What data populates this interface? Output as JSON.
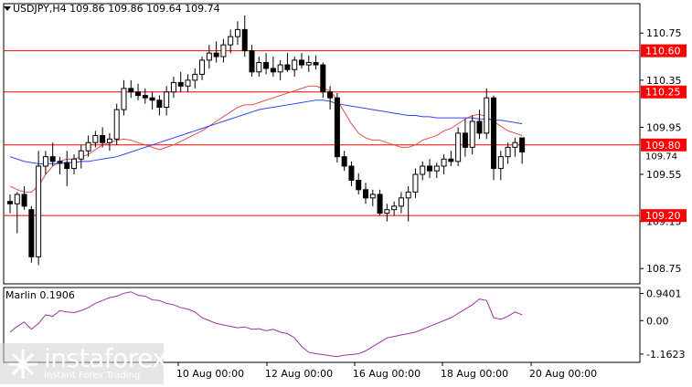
{
  "chart_data": [
    {
      "type": "candlestick",
      "title": "USDJPY,H4  109.86 109.86 109.64 109.74",
      "symbol": "USDJPY",
      "timeframe": "H4",
      "ohlc_last": {
        "open": 109.86,
        "high": 109.86,
        "low": 109.64,
        "close": 109.74
      },
      "ylim": [
        108.62,
        111.0
      ],
      "y_ticks": [
        "110.75",
        "110.35",
        "109.95",
        "109.55",
        "109.15",
        "108.75"
      ],
      "x_ticks": [
        "10 Aug 00:00",
        "12 Aug 00:00",
        "16 Aug 00:00",
        "18 Aug 00:00",
        "20 Aug 00:00"
      ],
      "levels": [
        {
          "label": "110.60",
          "value": 110.6,
          "color": "#ff0000"
        },
        {
          "label": "110.25",
          "value": 110.25,
          "color": "#ff0000"
        },
        {
          "label": "109.80",
          "value": 109.8,
          "color": "#ff0000"
        },
        {
          "label": "109.20",
          "value": 109.2,
          "color": "#ff0000"
        }
      ],
      "price_marker": {
        "label": "109.74",
        "value": 109.74
      },
      "candles": [
        [
          109.32,
          109.38,
          109.22,
          109.3
        ],
        [
          109.3,
          109.4,
          109.05,
          109.38
        ],
        [
          109.38,
          109.45,
          109.25,
          109.28
        ],
        [
          109.25,
          109.28,
          108.8,
          108.85
        ],
        [
          108.85,
          109.75,
          108.78,
          109.62
        ],
        [
          109.62,
          109.75,
          109.55,
          109.7
        ],
        [
          109.7,
          109.82,
          109.62,
          109.66
        ],
        [
          109.66,
          109.7,
          109.55,
          109.65
        ],
        [
          109.65,
          109.75,
          109.45,
          109.6
        ],
        [
          109.6,
          109.72,
          109.55,
          109.68
        ],
        [
          109.68,
          109.8,
          109.6,
          109.75
        ],
        [
          109.75,
          109.88,
          109.7,
          109.82
        ],
        [
          109.82,
          109.92,
          109.78,
          109.88
        ],
        [
          109.88,
          109.95,
          109.78,
          109.82
        ],
        [
          109.82,
          109.9,
          109.75,
          109.85
        ],
        [
          109.85,
          110.15,
          109.8,
          110.1
        ],
        [
          110.1,
          110.35,
          110.05,
          110.28
        ],
        [
          110.28,
          110.35,
          110.2,
          110.25
        ],
        [
          110.25,
          110.32,
          110.18,
          110.22
        ],
        [
          110.22,
          110.28,
          110.15,
          110.2
        ],
        [
          110.2,
          110.25,
          110.1,
          110.18
        ],
        [
          110.18,
          110.22,
          110.05,
          110.12
        ],
        [
          110.12,
          110.3,
          110.05,
          110.25
        ],
        [
          110.25,
          110.38,
          110.2,
          110.33
        ],
        [
          110.33,
          110.42,
          110.25,
          110.3
        ],
        [
          110.3,
          110.4,
          110.25,
          110.35
        ],
        [
          110.35,
          110.45,
          110.28,
          110.4
        ],
        [
          110.4,
          110.55,
          110.35,
          110.52
        ],
        [
          110.52,
          110.65,
          110.45,
          110.58
        ],
        [
          110.58,
          110.68,
          110.5,
          110.55
        ],
        [
          110.55,
          110.7,
          110.5,
          110.65
        ],
        [
          110.65,
          110.78,
          110.58,
          110.72
        ],
        [
          110.72,
          110.85,
          110.65,
          110.78
        ],
        [
          110.78,
          110.9,
          110.55,
          110.6
        ],
        [
          110.6,
          110.65,
          110.38,
          110.42
        ],
        [
          110.42,
          110.55,
          110.38,
          110.5
        ],
        [
          110.5,
          110.58,
          110.4,
          110.45
        ],
        [
          110.45,
          110.55,
          110.38,
          110.42
        ],
        [
          110.42,
          110.52,
          110.35,
          110.48
        ],
        [
          110.48,
          110.58,
          110.42,
          110.44
        ],
        [
          110.44,
          110.55,
          110.38,
          110.52
        ],
        [
          110.52,
          110.58,
          110.45,
          110.48
        ],
        [
          110.48,
          110.56,
          110.42,
          110.5
        ],
        [
          110.5,
          110.56,
          110.44,
          110.48
        ],
        [
          110.48,
          110.5,
          110.2,
          110.25
        ],
        [
          110.25,
          110.3,
          110.1,
          110.2
        ],
        [
          110.2,
          110.24,
          109.65,
          109.7
        ],
        [
          109.7,
          109.75,
          109.58,
          109.62
        ],
        [
          109.62,
          109.66,
          109.45,
          109.5
        ],
        [
          109.5,
          109.56,
          109.38,
          109.42
        ],
        [
          109.42,
          109.48,
          109.3,
          109.35
        ],
        [
          109.35,
          109.42,
          109.28,
          109.38
        ],
        [
          109.38,
          109.42,
          109.2,
          109.22
        ],
        [
          109.22,
          109.3,
          109.15,
          109.25
        ],
        [
          109.25,
          109.32,
          109.2,
          109.28
        ],
        [
          109.28,
          109.4,
          109.22,
          109.35
        ],
        [
          109.35,
          109.45,
          109.15,
          109.4
        ],
        [
          109.4,
          109.6,
          109.35,
          109.55
        ],
        [
          109.55,
          109.66,
          109.5,
          109.62
        ],
        [
          109.62,
          109.68,
          109.52,
          109.58
        ],
        [
          109.58,
          109.65,
          109.52,
          109.62
        ],
        [
          109.62,
          109.72,
          109.55,
          109.68
        ],
        [
          109.68,
          109.75,
          109.62,
          109.66
        ],
        [
          109.66,
          109.95,
          109.62,
          109.9
        ],
        [
          109.9,
          110.02,
          109.7,
          109.78
        ],
        [
          109.78,
          110.05,
          109.72,
          110.0
        ],
        [
          110.0,
          110.1,
          109.85,
          109.9
        ],
        [
          109.9,
          110.28,
          109.85,
          110.2
        ],
        [
          110.2,
          110.22,
          109.5,
          109.6
        ],
        [
          109.6,
          109.75,
          109.5,
          109.7
        ],
        [
          109.7,
          109.82,
          109.64,
          109.78
        ],
        [
          109.78,
          109.86,
          109.7,
          109.82
        ],
        [
          109.86,
          109.86,
          109.64,
          109.74
        ]
      ],
      "series": [
        {
          "name": "",
          "color": "#e05050",
          "values": [
            109.45,
            109.42,
            109.4,
            109.4,
            109.45,
            109.55,
            109.62,
            109.66,
            109.68,
            109.68,
            109.7,
            109.72,
            109.76,
            109.8,
            109.82,
            109.84,
            109.85,
            109.84,
            109.82,
            109.8,
            109.78,
            109.76,
            109.78,
            109.8,
            109.83,
            109.86,
            109.89,
            109.92,
            109.96,
            110.0,
            110.04,
            110.08,
            110.12,
            110.14,
            110.14,
            110.16,
            110.18,
            110.2,
            110.22,
            110.24,
            110.26,
            110.28,
            110.3,
            110.3,
            110.28,
            110.26,
            110.18,
            110.08,
            109.98,
            109.9,
            109.86,
            109.84,
            109.84,
            109.82,
            109.8,
            109.78,
            109.78,
            109.8,
            109.84,
            109.86,
            109.88,
            109.92,
            109.94,
            109.98,
            110.02,
            110.05,
            110.06,
            110.04,
            110.0,
            109.96,
            109.92,
            109.9,
            109.88
          ]
        },
        {
          "name": "",
          "color": "#3344ee",
          "values": [
            109.7,
            109.68,
            109.66,
            109.65,
            109.64,
            109.64,
            109.64,
            109.64,
            109.65,
            109.65,
            109.66,
            109.66,
            109.67,
            109.68,
            109.69,
            109.7,
            109.72,
            109.74,
            109.76,
            109.78,
            109.8,
            109.82,
            109.84,
            109.86,
            109.88,
            109.9,
            109.92,
            109.94,
            109.96,
            109.98,
            110.0,
            110.02,
            110.04,
            110.06,
            110.08,
            110.1,
            110.11,
            110.12,
            110.13,
            110.14,
            110.15,
            110.16,
            110.17,
            110.18,
            110.18,
            110.17,
            110.15,
            110.14,
            110.13,
            110.12,
            110.11,
            110.1,
            110.09,
            110.08,
            110.07,
            110.06,
            110.05,
            110.05,
            110.04,
            110.04,
            110.03,
            110.03,
            110.03,
            110.03,
            110.03,
            110.03,
            110.02,
            110.02,
            110.01,
            110.01,
            110.0,
            109.99,
            109.98
          ]
        }
      ]
    },
    {
      "type": "line",
      "title": "Marlin 0.1906",
      "ylim": [
        -1.45,
        1.15
      ],
      "y_ticks": [
        "0.9401",
        "0.00",
        "-1.1623"
      ],
      "series": [
        {
          "name": "Marlin",
          "color": "#993399",
          "values": [
            -0.4,
            -0.2,
            -0.05,
            -0.3,
            -0.1,
            0.2,
            0.15,
            0.35,
            0.3,
            0.28,
            0.35,
            0.45,
            0.6,
            0.7,
            0.8,
            0.85,
            0.95,
            1.0,
            0.88,
            0.85,
            0.72,
            0.7,
            0.6,
            0.55,
            0.45,
            0.4,
            0.3,
            0.1,
            0.0,
            -0.1,
            -0.15,
            -0.2,
            -0.25,
            -0.22,
            -0.3,
            -0.28,
            -0.35,
            -0.3,
            -0.4,
            -0.45,
            -0.6,
            -0.9,
            -1.1,
            -1.15,
            -1.18,
            -1.22,
            -1.25,
            -1.2,
            -1.18,
            -1.15,
            -1.05,
            -0.9,
            -0.75,
            -0.6,
            -0.55,
            -0.5,
            -0.45,
            -0.4,
            -0.3,
            -0.2,
            -0.1,
            0.0,
            0.1,
            0.25,
            0.4,
            0.55,
            0.75,
            0.7,
            0.1,
            0.05,
            0.15,
            0.3,
            0.2
          ]
        }
      ]
    }
  ],
  "logo": {
    "main": "instaforex",
    "sub": "Instant Forex Trading"
  }
}
